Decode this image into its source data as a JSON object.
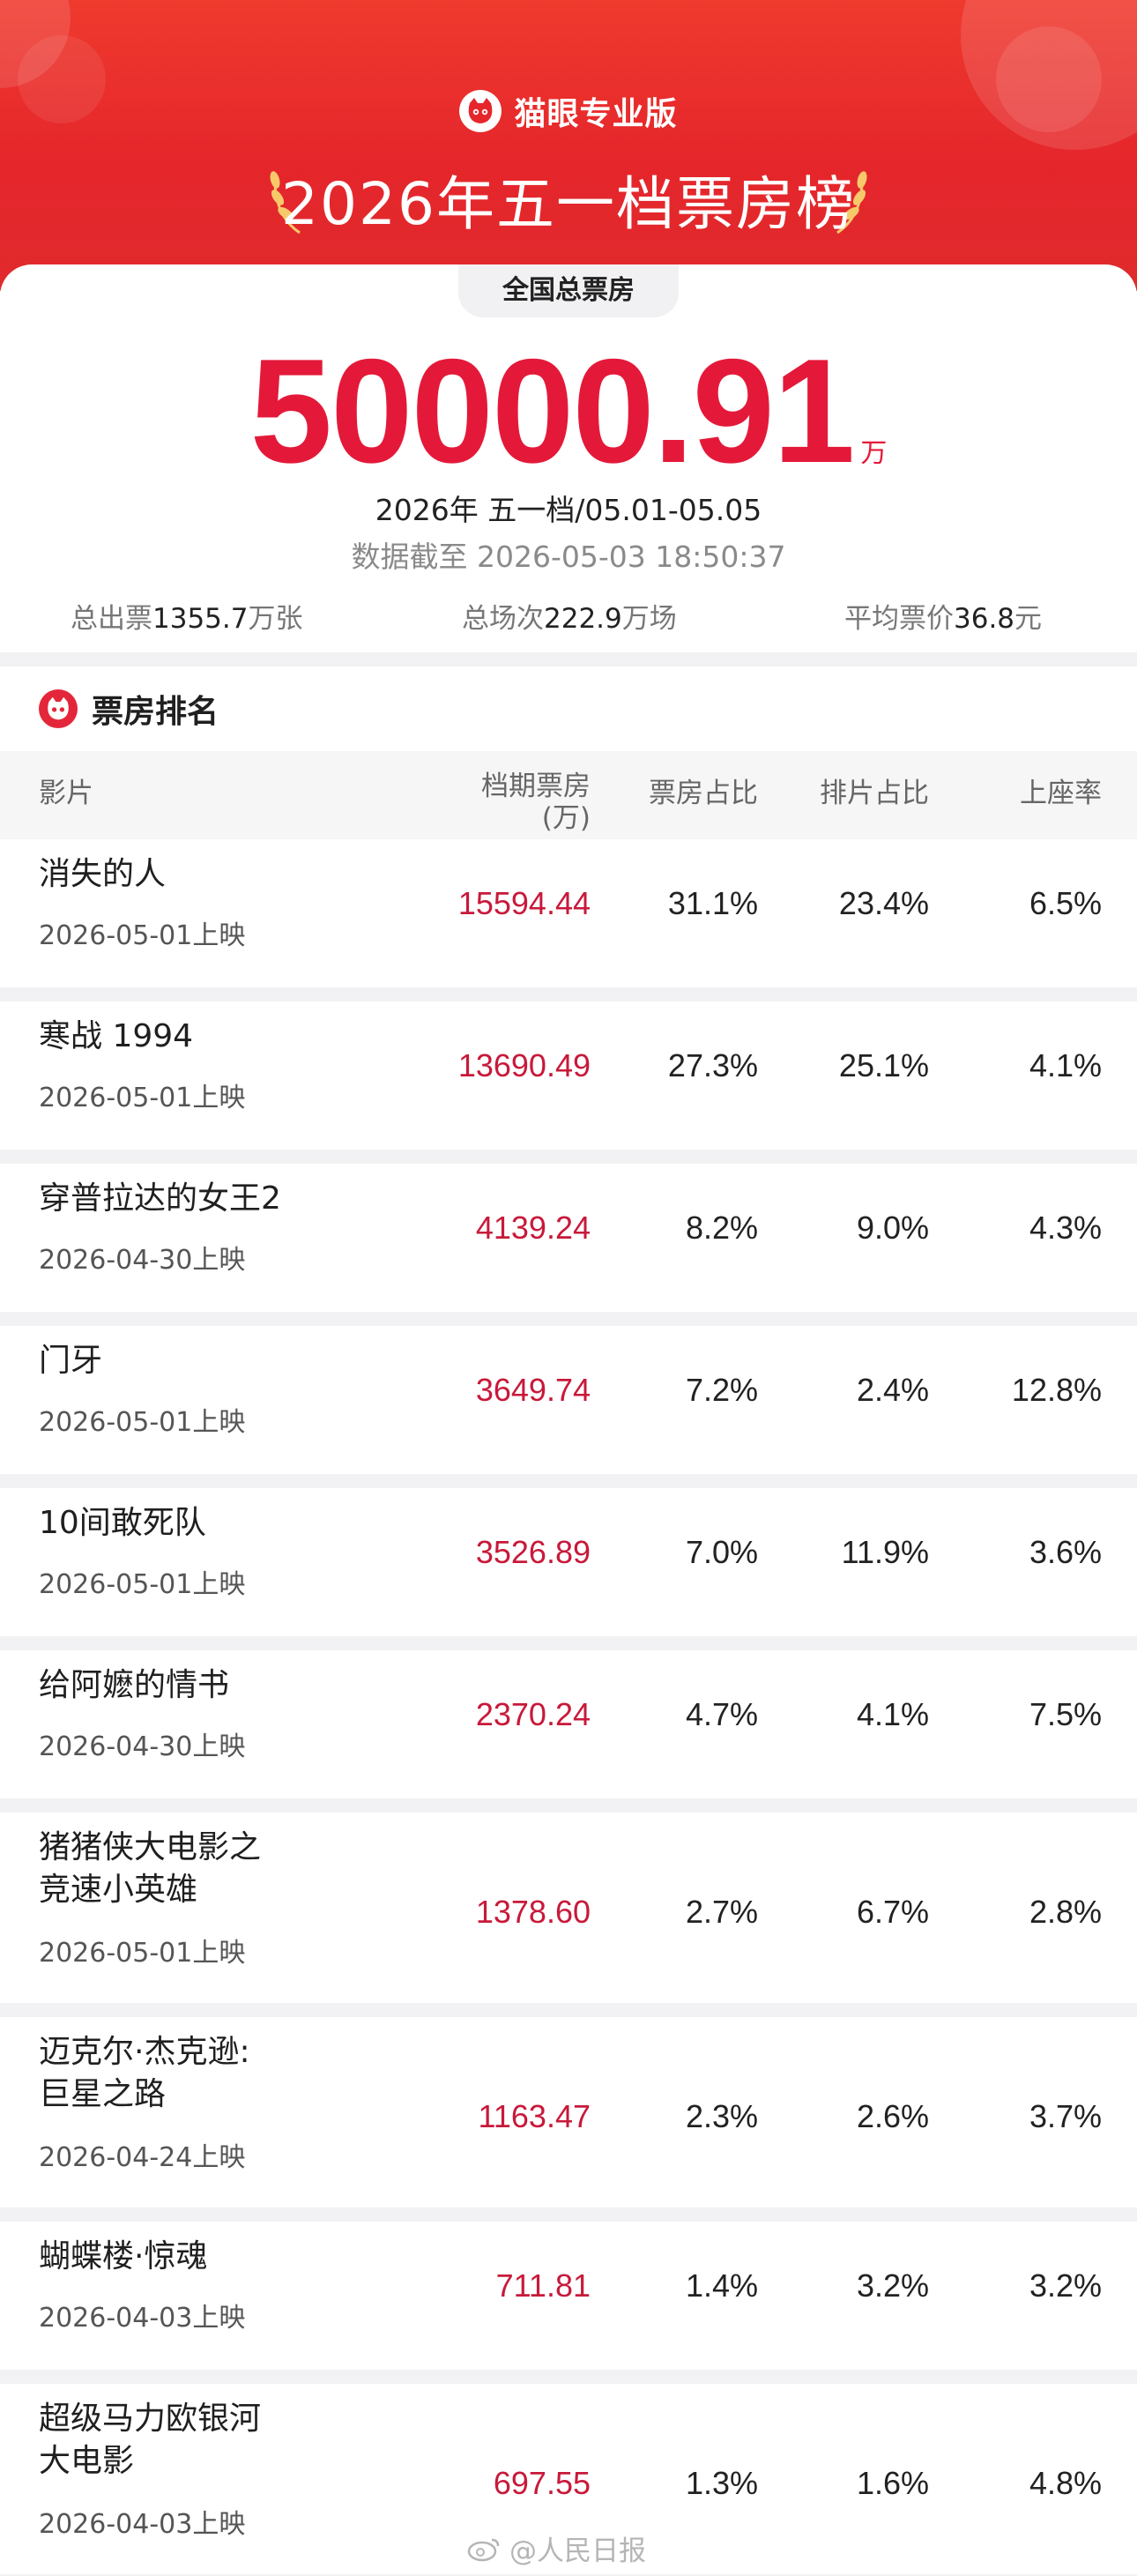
{
  "app": {
    "brand": "猫眼专业版",
    "title": "2026年五一档票房榜"
  },
  "summary": {
    "pill": "全国总票房",
    "total": "50000.91",
    "unit": "万",
    "period": "2026年 五一档/05.01-05.05",
    "cutoff": "数据截至 2026-05-03 18:50:37",
    "stats": [
      {
        "label": "总出票",
        "value": "1355.7",
        "unit": "万张"
      },
      {
        "label": "总场次",
        "value": "222.9",
        "unit": "万场"
      },
      {
        "label": "平均票价",
        "value": "36.8",
        "unit": "元"
      }
    ]
  },
  "ranking": {
    "title": "票房排名",
    "columns": [
      "影片",
      "档期票房",
      "(万)",
      "票房占比",
      "排片占比",
      "上座率"
    ],
    "rows": [
      {
        "title": [
          "消失的人"
        ],
        "date": "2026-05-01上映",
        "box": "15594.44",
        "share": "31.1%",
        "sched": "23.4%",
        "occ": "6.5%"
      },
      {
        "title": [
          "寒战 1994"
        ],
        "date": "2026-05-01上映",
        "box": "13690.49",
        "share": "27.3%",
        "sched": "25.1%",
        "occ": "4.1%"
      },
      {
        "title": [
          "穿普拉达的女王2"
        ],
        "date": "2026-04-30上映",
        "box": "4139.24",
        "share": "8.2%",
        "sched": "9.0%",
        "occ": "4.3%"
      },
      {
        "title": [
          "门牙"
        ],
        "date": "2026-05-01上映",
        "box": "3649.74",
        "share": "7.2%",
        "sched": "2.4%",
        "occ": "12.8%"
      },
      {
        "title": [
          "10间敢死队"
        ],
        "date": "2026-05-01上映",
        "box": "3526.89",
        "share": "7.0%",
        "sched": "11.9%",
        "occ": "3.6%"
      },
      {
        "title": [
          "给阿嬷的情书"
        ],
        "date": "2026-04-30上映",
        "box": "2370.24",
        "share": "4.7%",
        "sched": "4.1%",
        "occ": "7.5%"
      },
      {
        "title": [
          "猪猪侠大电影之",
          "竞速小英雄"
        ],
        "date": "2026-05-01上映",
        "box": "1378.60",
        "share": "2.7%",
        "sched": "6.7%",
        "occ": "2.8%"
      },
      {
        "title": [
          "迈克尔·杰克逊:",
          "巨星之路"
        ],
        "date": "2026-04-24上映",
        "box": "1163.47",
        "share": "2.3%",
        "sched": "2.6%",
        "occ": "3.7%"
      },
      {
        "title": [
          "蝴蝶楼·惊魂"
        ],
        "date": "2026-04-03上映",
        "box": "711.81",
        "share": "1.4%",
        "sched": "3.2%",
        "occ": "3.2%"
      },
      {
        "title": [
          "超级马力欧银河",
          "大电影"
        ],
        "date": "2026-04-03上映",
        "box": "697.55",
        "share": "1.3%",
        "sched": "1.6%",
        "occ": "4.8%"
      }
    ]
  },
  "watermark": "@人民日报",
  "icons": {
    "brand": "cat-logo-icon",
    "watermark": "weibo-icon"
  },
  "colors": {
    "header": "#e5262b",
    "accent": "#e4193a",
    "box_value": "#c8193a"
  }
}
